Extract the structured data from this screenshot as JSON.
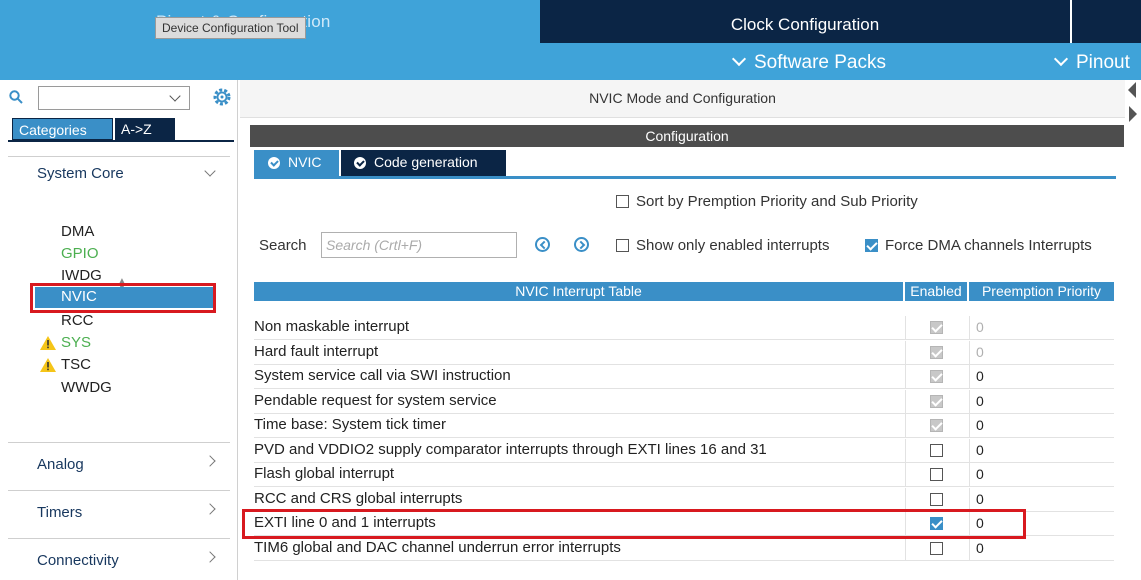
{
  "tabs": {
    "pinout_label": "Pinout & Configuration",
    "tooltip": "Device Configuration Tool",
    "clock_label": "Clock Configuration"
  },
  "menu": {
    "software_packs": "Software Packs",
    "pinout": "Pinout"
  },
  "sidebar": {
    "tab_categories": "Categories",
    "tab_atoz": "A->Z",
    "sections": {
      "system_core": "System Core",
      "analog": "Analog",
      "timers": "Timers",
      "connectivity": "Connectivity"
    },
    "core_items": {
      "dma": "DMA",
      "gpio": "GPIO",
      "iwdg": "IWDG",
      "nvic": "NVIC",
      "rcc": "RCC",
      "sys": "SYS",
      "tsc": "TSC",
      "wwdg": "WWDG"
    }
  },
  "main": {
    "mode_title": "NVIC Mode and Configuration",
    "config_title": "Configuration",
    "tab_nvic": "NVIC",
    "tab_codegen": "Code generation",
    "sort_label": "Sort by Premption Priority and Sub Priority",
    "search_label": "Search",
    "search_placeholder": "Search (Crtl+F)",
    "show_enabled_label": "Show only enabled interrupts",
    "force_dma_label": "Force DMA channels Interrupts",
    "table": {
      "col_name": "NVIC Interrupt Table",
      "col_enabled": "Enabled",
      "col_priority": "Preemption Priority",
      "rows": [
        {
          "name": "Non maskable interrupt",
          "enabled": true,
          "locked": true,
          "priority": "0"
        },
        {
          "name": "Hard fault interrupt",
          "enabled": true,
          "locked": true,
          "priority": "0"
        },
        {
          "name": "System service call via SWI instruction",
          "enabled": true,
          "locked": true,
          "priority": "0"
        },
        {
          "name": "Pendable request for system service",
          "enabled": true,
          "locked": true,
          "priority": "0"
        },
        {
          "name": "Time base: System tick timer",
          "enabled": true,
          "locked": true,
          "priority": "0"
        },
        {
          "name": "PVD and VDDIO2 supply comparator interrupts through EXTI lines 16 and 31",
          "enabled": false,
          "locked": false,
          "priority": "0"
        },
        {
          "name": "Flash global interrupt",
          "enabled": false,
          "locked": false,
          "priority": "0"
        },
        {
          "name": "RCC and CRS global interrupts",
          "enabled": false,
          "locked": false,
          "priority": "0"
        },
        {
          "name": "EXTI line 0 and 1 interrupts",
          "enabled": true,
          "locked": false,
          "priority": "0"
        },
        {
          "name": "TIM6 global and DAC channel underrun error interrupts",
          "enabled": false,
          "locked": false,
          "priority": "0"
        }
      ]
    }
  },
  "colors": {
    "accent": "#3a8fc7",
    "dark": "#0b2545",
    "highlight": "#d8191f",
    "warning": "#f5c518"
  }
}
